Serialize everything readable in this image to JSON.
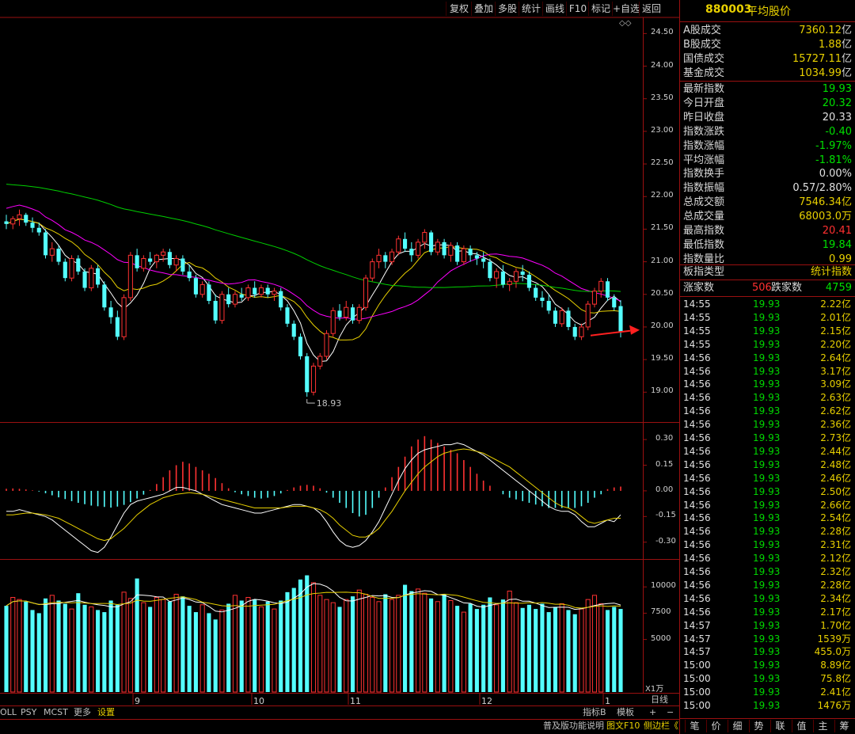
{
  "toolbar": {
    "buttons": [
      "复权",
      "叠加",
      "多股",
      "统计",
      "画线",
      "F10",
      "标记",
      "+自选",
      "返回"
    ],
    "diamond_icons": "◇◇"
  },
  "chart_data": {
    "type": "candlestick",
    "title": "",
    "colors": {
      "up": "#ff3232",
      "down": "#54ffff",
      "ma_short": "#ffffff",
      "ma_mid": "#e8d000",
      "ma_long": "#ff00ff",
      "ma_longest": "#00d000"
    },
    "price_axis": {
      "ticks": [
        "24.50",
        "24.00",
        "23.50",
        "23.00",
        "22.50",
        "22.00",
        "21.50",
        "21.00",
        "20.50",
        "20.00",
        "19.50",
        "19.00"
      ],
      "min": 18.7,
      "max": 24.65
    },
    "x_labels": [
      "9",
      "10",
      "11",
      "12",
      "1"
    ],
    "candles": [
      [
        21.62,
        21.72,
        21.5,
        21.58
      ],
      [
        21.58,
        21.7,
        21.5,
        21.66
      ],
      [
        21.66,
        21.8,
        21.55,
        21.72
      ],
      [
        21.72,
        21.75,
        21.55,
        21.6
      ],
      [
        21.6,
        21.68,
        21.45,
        21.52
      ],
      [
        21.52,
        21.6,
        21.4,
        21.45
      ],
      [
        21.45,
        21.5,
        21.05,
        21.1
      ],
      [
        21.1,
        21.3,
        21.0,
        21.2
      ],
      [
        21.2,
        21.25,
        20.95,
        21.0
      ],
      [
        21.0,
        21.05,
        20.7,
        20.75
      ],
      [
        20.75,
        21.1,
        20.7,
        21.05
      ],
      [
        21.05,
        21.1,
        20.8,
        20.85
      ],
      [
        20.85,
        20.9,
        20.55,
        20.6
      ],
      [
        20.6,
        20.95,
        20.55,
        20.9
      ],
      [
        20.9,
        20.95,
        20.6,
        20.65
      ],
      [
        20.65,
        20.7,
        20.25,
        20.3
      ],
      [
        20.3,
        20.4,
        20.05,
        20.15
      ],
      [
        20.15,
        20.25,
        19.8,
        19.85
      ],
      [
        19.85,
        20.5,
        19.8,
        20.45
      ],
      [
        20.45,
        21.15,
        20.4,
        21.1
      ],
      [
        21.1,
        21.2,
        20.85,
        20.9
      ],
      [
        20.9,
        21.1,
        20.85,
        21.05
      ],
      [
        21.05,
        21.15,
        20.95,
        21.0
      ],
      [
        21.0,
        21.12,
        20.9,
        21.1
      ],
      [
        21.1,
        21.2,
        21.0,
        21.15
      ],
      [
        21.15,
        21.2,
        20.9,
        20.95
      ],
      [
        20.95,
        21.1,
        20.85,
        21.05
      ],
      [
        21.05,
        21.1,
        20.8,
        20.85
      ],
      [
        20.85,
        20.95,
        20.7,
        20.75
      ],
      [
        20.75,
        20.8,
        20.45,
        20.5
      ],
      [
        20.5,
        20.7,
        20.45,
        20.65
      ],
      [
        20.65,
        20.7,
        20.35,
        20.4
      ],
      [
        20.4,
        20.5,
        20.05,
        20.1
      ],
      [
        20.1,
        20.55,
        20.05,
        20.5
      ],
      [
        20.5,
        20.6,
        20.3,
        20.35
      ],
      [
        20.35,
        20.55,
        20.3,
        20.5
      ],
      [
        20.5,
        20.6,
        20.4,
        20.45
      ],
      [
        20.45,
        20.65,
        20.4,
        20.6
      ],
      [
        20.6,
        20.7,
        20.45,
        20.5
      ],
      [
        20.5,
        20.65,
        20.45,
        20.6
      ],
      [
        20.6,
        20.65,
        20.45,
        20.5
      ],
      [
        20.5,
        20.6,
        20.4,
        20.55
      ],
      [
        20.55,
        20.6,
        20.25,
        20.3
      ],
      [
        20.3,
        20.35,
        20.0,
        20.05
      ],
      [
        20.05,
        20.1,
        19.8,
        19.85
      ],
      [
        19.85,
        19.9,
        19.5,
        19.55
      ],
      [
        19.55,
        19.6,
        18.93,
        19.0
      ],
      [
        19.0,
        19.45,
        18.95,
        19.4
      ],
      [
        19.4,
        19.6,
        19.35,
        19.55
      ],
      [
        19.55,
        19.95,
        19.5,
        19.9
      ],
      [
        19.9,
        20.3,
        19.85,
        20.25
      ],
      [
        20.25,
        20.35,
        20.1,
        20.15
      ],
      [
        20.15,
        20.4,
        20.1,
        20.3
      ],
      [
        20.3,
        20.35,
        20.05,
        20.1
      ],
      [
        20.1,
        20.35,
        20.05,
        20.3
      ],
      [
        20.3,
        20.8,
        20.25,
        20.75
      ],
      [
        20.75,
        21.05,
        20.7,
        21.0
      ],
      [
        21.0,
        21.2,
        20.9,
        21.1
      ],
      [
        21.1,
        21.15,
        20.9,
        21.0
      ],
      [
        21.0,
        21.2,
        20.95,
        21.15
      ],
      [
        21.15,
        21.4,
        21.1,
        21.35
      ],
      [
        21.35,
        21.45,
        21.15,
        21.2
      ],
      [
        21.2,
        21.3,
        21.0,
        21.1
      ],
      [
        21.1,
        21.35,
        21.05,
        21.3
      ],
      [
        21.3,
        21.5,
        21.2,
        21.45
      ],
      [
        21.45,
        21.48,
        21.1,
        21.15
      ],
      [
        21.15,
        21.35,
        21.1,
        21.3
      ],
      [
        21.3,
        21.35,
        21.05,
        21.1
      ],
      [
        21.1,
        21.3,
        21.0,
        21.25
      ],
      [
        21.25,
        21.3,
        20.95,
        21.0
      ],
      [
        21.0,
        21.25,
        20.95,
        21.2
      ],
      [
        21.2,
        21.25,
        21.0,
        21.1
      ],
      [
        21.1,
        21.15,
        20.95,
        21.05
      ],
      [
        21.05,
        21.15,
        20.9,
        21.0
      ],
      [
        21.0,
        21.05,
        20.7,
        20.75
      ],
      [
        20.75,
        20.9,
        20.6,
        20.85
      ],
      [
        20.85,
        20.95,
        20.6,
        20.65
      ],
      [
        20.65,
        20.75,
        20.55,
        20.7
      ],
      [
        20.7,
        20.9,
        20.6,
        20.85
      ],
      [
        20.85,
        20.95,
        20.7,
        20.8
      ],
      [
        20.8,
        20.85,
        20.55,
        20.6
      ],
      [
        20.6,
        20.65,
        20.4,
        20.45
      ],
      [
        20.45,
        20.55,
        20.3,
        20.4
      ],
      [
        20.4,
        20.5,
        20.2,
        20.25
      ],
      [
        20.25,
        20.3,
        20.0,
        20.05
      ],
      [
        20.05,
        20.3,
        20.0,
        20.25
      ],
      [
        20.25,
        20.3,
        19.95,
        20.0
      ],
      [
        20.0,
        20.05,
        19.8,
        19.85
      ],
      [
        19.85,
        20.05,
        19.8,
        20.0
      ],
      [
        20.0,
        20.4,
        19.95,
        20.35
      ],
      [
        20.35,
        20.6,
        20.3,
        20.55
      ],
      [
        20.55,
        20.75,
        20.45,
        20.7
      ],
      [
        20.7,
        20.75,
        20.4,
        20.45
      ],
      [
        20.45,
        20.5,
        20.25,
        20.3
      ],
      [
        20.32,
        20.41,
        19.84,
        19.93
      ]
    ],
    "low_marker_label": "18.93",
    "arrow_color": "#ff2020",
    "macd_axis": {
      "ticks": [
        "0.30",
        "0.15",
        "0.00",
        "-0.15",
        "-0.30"
      ],
      "min": -0.38,
      "max": 0.37
    },
    "macd_hist": [
      0.012,
      0.014,
      0.012,
      0.008,
      0.003,
      -0.004,
      -0.014,
      -0.026,
      -0.038,
      -0.048,
      -0.06,
      -0.07,
      -0.078,
      -0.086,
      -0.09,
      -0.094,
      -0.098,
      -0.092,
      -0.082,
      -0.066,
      -0.045,
      -0.022,
      0.005,
      0.04,
      0.08,
      0.12,
      0.15,
      0.17,
      0.16,
      0.14,
      0.12,
      0.1,
      0.075,
      0.045,
      0.015,
      -0.008,
      -0.02,
      -0.03,
      -0.04,
      -0.045,
      -0.04,
      -0.03,
      -0.015,
      0.005,
      0.02,
      0.03,
      0.035,
      0.03,
      0.015,
      -0.01,
      -0.04,
      -0.07,
      -0.1,
      -0.13,
      -0.15,
      -0.14,
      -0.1,
      -0.04,
      0.02,
      0.08,
      0.14,
      0.2,
      0.26,
      0.3,
      0.32,
      0.3,
      0.28,
      0.26,
      0.24,
      0.22,
      0.18,
      0.14,
      0.1,
      0.06,
      0.03,
      0.0,
      -0.02,
      -0.04,
      -0.05,
      -0.06,
      -0.07,
      -0.08,
      -0.09,
      -0.1,
      -0.1,
      -0.1,
      -0.1,
      -0.1,
      -0.09,
      -0.07,
      -0.04,
      -0.02,
      0.01,
      0.02,
      0.025
    ],
    "macd_dif": [
      -0.12,
      -0.12,
      -0.11,
      -0.12,
      -0.13,
      -0.14,
      -0.15,
      -0.17,
      -0.2,
      -0.23,
      -0.26,
      -0.29,
      -0.32,
      -0.35,
      -0.36,
      -0.33,
      -0.27,
      -0.2,
      -0.13,
      -0.08,
      -0.06,
      -0.05,
      -0.04,
      -0.03,
      -0.02,
      0.0,
      0.02,
      0.02,
      0.01,
      0.0,
      -0.02,
      -0.04,
      -0.06,
      -0.08,
      -0.09,
      -0.1,
      -0.11,
      -0.12,
      -0.13,
      -0.13,
      -0.12,
      -0.11,
      -0.1,
      -0.09,
      -0.08,
      -0.08,
      -0.09,
      -0.1,
      -0.13,
      -0.18,
      -0.24,
      -0.29,
      -0.32,
      -0.33,
      -0.32,
      -0.29,
      -0.24,
      -0.18,
      -0.1,
      -0.02,
      0.06,
      0.13,
      0.18,
      0.22,
      0.24,
      0.25,
      0.26,
      0.27,
      0.27,
      0.28,
      0.27,
      0.25,
      0.23,
      0.21,
      0.18,
      0.15,
      0.12,
      0.09,
      0.06,
      0.03,
      0.0,
      -0.03,
      -0.06,
      -0.09,
      -0.11,
      -0.12,
      -0.12,
      -0.14,
      -0.18,
      -0.21,
      -0.21,
      -0.19,
      -0.17,
      -0.18,
      -0.14
    ],
    "macd_dea": [
      -0.14,
      -0.14,
      -0.135,
      -0.13,
      -0.13,
      -0.135,
      -0.14,
      -0.15,
      -0.16,
      -0.18,
      -0.2,
      -0.22,
      -0.24,
      -0.26,
      -0.28,
      -0.29,
      -0.28,
      -0.25,
      -0.22,
      -0.18,
      -0.14,
      -0.11,
      -0.08,
      -0.06,
      -0.04,
      -0.03,
      -0.02,
      -0.015,
      -0.01,
      -0.015,
      -0.02,
      -0.03,
      -0.04,
      -0.05,
      -0.06,
      -0.07,
      -0.08,
      -0.09,
      -0.1,
      -0.1,
      -0.1,
      -0.1,
      -0.1,
      -0.095,
      -0.09,
      -0.09,
      -0.09,
      -0.1,
      -0.11,
      -0.13,
      -0.16,
      -0.2,
      -0.23,
      -0.26,
      -0.27,
      -0.27,
      -0.25,
      -0.22,
      -0.17,
      -0.12,
      -0.06,
      0.0,
      0.05,
      0.1,
      0.14,
      0.17,
      0.2,
      0.22,
      0.23,
      0.24,
      0.245,
      0.24,
      0.23,
      0.22,
      0.2,
      0.18,
      0.16,
      0.14,
      0.11,
      0.08,
      0.05,
      0.02,
      -0.01,
      -0.04,
      -0.07,
      -0.09,
      -0.1,
      -0.12,
      -0.15,
      -0.18,
      -0.19,
      -0.18,
      -0.17,
      -0.16,
      -0.16
    ],
    "volume_axis": {
      "ticks": [
        "10000",
        "7500",
        "5000"
      ],
      "unit_label": "X1万",
      "min": 0,
      "max": 12200
    },
    "volume": [
      8200,
      9000,
      8800,
      8600,
      7800,
      7500,
      8900,
      9200,
      8700,
      8400,
      7900,
      9400,
      8300,
      8100,
      7800,
      7600,
      8700,
      8300,
      9500,
      8900,
      10800,
      8500,
      8100,
      9000,
      8800,
      8600,
      9300,
      9100,
      8200,
      7600,
      8300,
      7500,
      6900,
      7800,
      8400,
      9200,
      8700,
      9000,
      8800,
      8100,
      8600,
      7900,
      8700,
      9500,
      9900,
      10700,
      11100,
      10400,
      9200,
      8800,
      8500,
      8100,
      8800,
      9100,
      9700,
      9300,
      9000,
      8600,
      9300,
      8800,
      9200,
      10200,
      9600,
      9800,
      9400,
      8900,
      8600,
      9300,
      8700,
      8200,
      7600,
      8400,
      7900,
      8300,
      9000,
      8300,
      8800,
      9600,
      8500,
      8000,
      8300,
      7900,
      8400,
      7600,
      8100,
      8400,
      7800,
      7400,
      7900,
      8800,
      9200,
      8400,
      7800,
      8100,
      7900
    ]
  },
  "bottom_tabs": {
    "items": [
      "OLL",
      "PSY",
      "MCST",
      "更多",
      "设置"
    ],
    "index_btn": "指标B",
    "template_btn": "模板",
    "plus": "+",
    "minus": "−",
    "period": "日线",
    "help": "普及版功能说明",
    "f10": "图文F10",
    "sidebar": "侧边栏《"
  },
  "panel": {
    "code": "880003",
    "name": "平均股价",
    "market_rows": [
      {
        "label": "A股成交",
        "value": "7360.12",
        "unit": "亿"
      },
      {
        "label": "B股成交",
        "value": "1.88",
        "unit": "亿"
      },
      {
        "label": "国债成交",
        "value": "15727.11",
        "unit": "亿"
      },
      {
        "label": "基金成交",
        "value": "1034.99",
        "unit": "亿"
      }
    ],
    "quote_rows": [
      {
        "label": "最新指数",
        "value": "19.93",
        "color": "#00e000"
      },
      {
        "label": "今日开盘",
        "value": "20.32",
        "color": "#00e000"
      },
      {
        "label": "昨日收盘",
        "value": "20.33",
        "color": "#e0e0e0"
      },
      {
        "label": "指数涨跌",
        "value": "-0.40",
        "color": "#00e000"
      },
      {
        "label": "指数涨幅",
        "value": "-1.97%",
        "color": "#00e000"
      },
      {
        "label": "平均涨幅",
        "value": "-1.81%",
        "color": "#00e000"
      },
      {
        "label": "指数换手",
        "value": "0.00%",
        "color": "#e0e0e0"
      },
      {
        "label": "指数振幅",
        "value": "0.57/2.80%",
        "color": "#e0e0e0"
      },
      {
        "label": "总成交额",
        "value": "7546.34亿",
        "color": "#e8d000"
      },
      {
        "label": "总成交量",
        "value": "68003.0万",
        "color": "#e8d000"
      },
      {
        "label": "最高指数",
        "value": "20.41",
        "color": "#ff3030"
      },
      {
        "label": "最低指数",
        "value": "19.84",
        "color": "#00e000"
      },
      {
        "label": "指数量比",
        "value": "0.99",
        "color": "#e8d000"
      }
    ],
    "board_label": "板指类型",
    "board_value": "统计指数",
    "up_label": "涨家数",
    "up_value": "506",
    "down_label": "跌家数",
    "down_value": "4759",
    "ticks": [
      {
        "time": "14:55",
        "price": "19.93",
        "vol": "2.22亿"
      },
      {
        "time": "14:55",
        "price": "19.93",
        "vol": "2.01亿"
      },
      {
        "time": "14:55",
        "price": "19.93",
        "vol": "2.15亿"
      },
      {
        "time": "14:55",
        "price": "19.93",
        "vol": "2.20亿"
      },
      {
        "time": "14:56",
        "price": "19.93",
        "vol": "2.64亿"
      },
      {
        "time": "14:56",
        "price": "19.93",
        "vol": "3.17亿"
      },
      {
        "time": "14:56",
        "price": "19.93",
        "vol": "3.09亿"
      },
      {
        "time": "14:56",
        "price": "19.93",
        "vol": "2.63亿"
      },
      {
        "time": "14:56",
        "price": "19.93",
        "vol": "2.62亿"
      },
      {
        "time": "14:56",
        "price": "19.93",
        "vol": "2.36亿"
      },
      {
        "time": "14:56",
        "price": "19.93",
        "vol": "2.73亿"
      },
      {
        "time": "14:56",
        "price": "19.93",
        "vol": "2.44亿"
      },
      {
        "time": "14:56",
        "price": "19.93",
        "vol": "2.48亿"
      },
      {
        "time": "14:56",
        "price": "19.93",
        "vol": "2.46亿"
      },
      {
        "time": "14:56",
        "price": "19.93",
        "vol": "2.50亿"
      },
      {
        "time": "14:56",
        "price": "19.93",
        "vol": "2.66亿"
      },
      {
        "time": "14:56",
        "price": "19.93",
        "vol": "2.54亿"
      },
      {
        "time": "14:56",
        "price": "19.93",
        "vol": "2.28亿"
      },
      {
        "time": "14:56",
        "price": "19.93",
        "vol": "2.31亿"
      },
      {
        "time": "14:56",
        "price": "19.93",
        "vol": "2.12亿"
      },
      {
        "time": "14:56",
        "price": "19.93",
        "vol": "2.32亿"
      },
      {
        "time": "14:56",
        "price": "19.93",
        "vol": "2.28亿"
      },
      {
        "time": "14:56",
        "price": "19.93",
        "vol": "2.34亿"
      },
      {
        "time": "14:56",
        "price": "19.93",
        "vol": "2.17亿"
      },
      {
        "time": "14:57",
        "price": "19.93",
        "vol": "1.70亿"
      },
      {
        "time": "14:57",
        "price": "19.93",
        "vol": "1539万"
      },
      {
        "time": "14:57",
        "price": "19.93",
        "vol": "455.0万"
      },
      {
        "time": "15:00",
        "price": "19.93",
        "vol": "8.89亿"
      },
      {
        "time": "15:00",
        "price": "19.93",
        "vol": "75.8亿"
      },
      {
        "time": "15:00",
        "price": "19.93",
        "vol": "2.41亿"
      },
      {
        "time": "15:00",
        "price": "19.93",
        "vol": "1476万"
      }
    ],
    "tabs": [
      "笔",
      "价",
      "细",
      "势",
      "联",
      "值",
      "主",
      "筹"
    ]
  }
}
